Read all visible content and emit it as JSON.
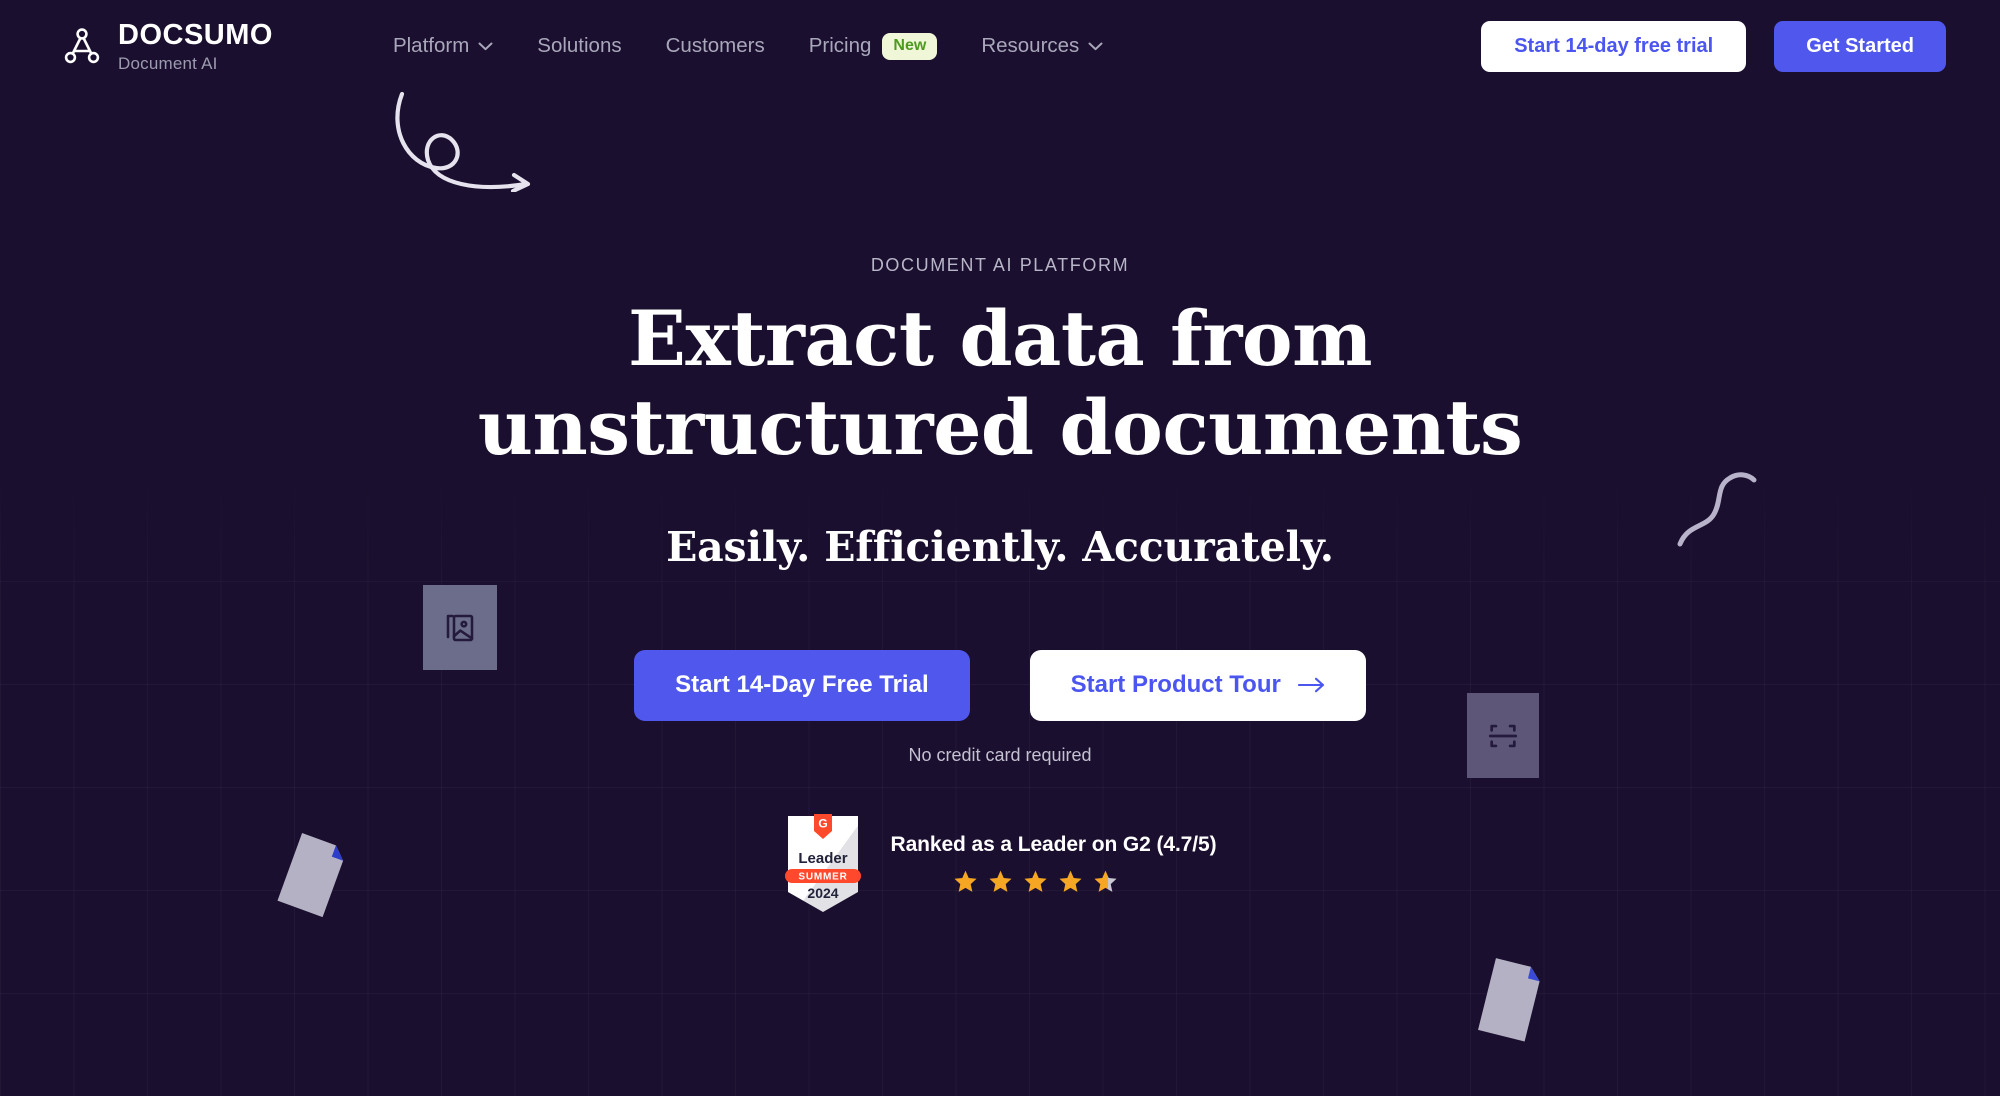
{
  "brand": {
    "name": "DOCSUMO",
    "tagline": "Document AI",
    "logo_icon": "docsumo-node-triangle-icon"
  },
  "nav": {
    "links": [
      {
        "label": "Platform",
        "has_dropdown": true,
        "badge": null
      },
      {
        "label": "Solutions",
        "has_dropdown": false,
        "badge": null
      },
      {
        "label": "Customers",
        "has_dropdown": false,
        "badge": null
      },
      {
        "label": "Pricing",
        "has_dropdown": false,
        "badge": "New"
      },
      {
        "label": "Resources",
        "has_dropdown": true,
        "badge": null
      }
    ],
    "trial_button": "Start 14-day free trial",
    "get_started_button": "Get Started"
  },
  "hero": {
    "eyebrow": "DOCUMENT AI PLATFORM",
    "title_line1": "Extract data from",
    "title_line2": "unstructured documents",
    "subtitle": "Easily. Efficiently. Accurately.",
    "primary_cta": "Start 14-Day Free Trial",
    "secondary_cta": "Start Product Tour",
    "secondary_cta_icon": "arrow-right-icon",
    "disclaimer": "No credit card required"
  },
  "social_proof": {
    "badge": {
      "award": "Leader",
      "season": "SUMMER",
      "year": "2024",
      "logo": "g2-logo-icon"
    },
    "headline": "Ranked as a Leader on G2 (4.7/5)",
    "rating": 4.7,
    "rating_max": 5,
    "stars_full": 4,
    "stars_partial": 0.7
  },
  "decor": {
    "arrow_doodle": "curved-loop-arrow-decoration",
    "squiggle": "s-curve-squiggle-decoration",
    "card_image_icon": "image-document-icon",
    "card_scan_icon": "scan-document-icon",
    "floating_doc_left": "tilted-page-decoration",
    "floating_doc_right": "tilted-page-decoration"
  },
  "colors": {
    "background": "#1a0f2e",
    "accent_blue": "#4f57ed",
    "badge_new_bg": "#f0f7d9",
    "badge_new_text": "#4e9a1f",
    "star_gold": "#f5a623",
    "g2_orange": "#ff492c",
    "muted_text": "#a9a7bb"
  }
}
